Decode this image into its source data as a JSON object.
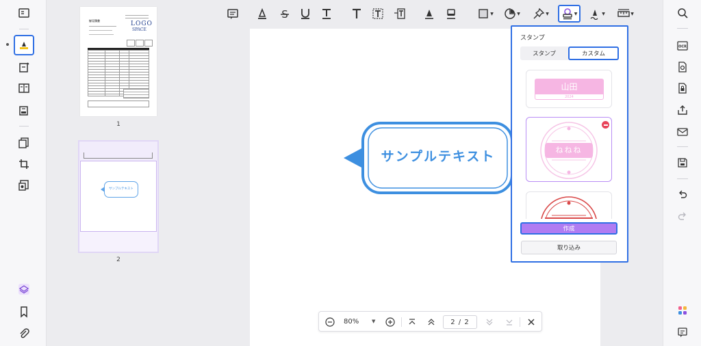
{
  "thumbnails": [
    {
      "page_number": "1",
      "logo_text_1": "LOGO",
      "logo_text_2": "SPACE",
      "doc_heading": "御見積書"
    },
    {
      "page_number": "2",
      "mini_callout_text": "サンプルテキスト"
    }
  ],
  "callout": {
    "text": "サンプルテキスト"
  },
  "stamp_panel": {
    "title": "スタンプ",
    "tabs": [
      {
        "label": "スタンプ",
        "selected": false
      },
      {
        "label": "カスタム",
        "selected": true
      }
    ],
    "cards": [
      {
        "name": "山田",
        "subtext": "2024"
      },
      {
        "name": "ねねね"
      },
      {
        "name": ""
      }
    ],
    "create_label": "作成",
    "import_label": "取り込み"
  },
  "zoom_bar": {
    "zoom": "80%",
    "page_indicator": "2 / 2"
  },
  "colors": {
    "accent_blue": "#2f6fe4",
    "callout_blue": "#3d8fe0",
    "stamp_purple": "#b07cf2",
    "stamp_pink": "#f6b6e3"
  }
}
